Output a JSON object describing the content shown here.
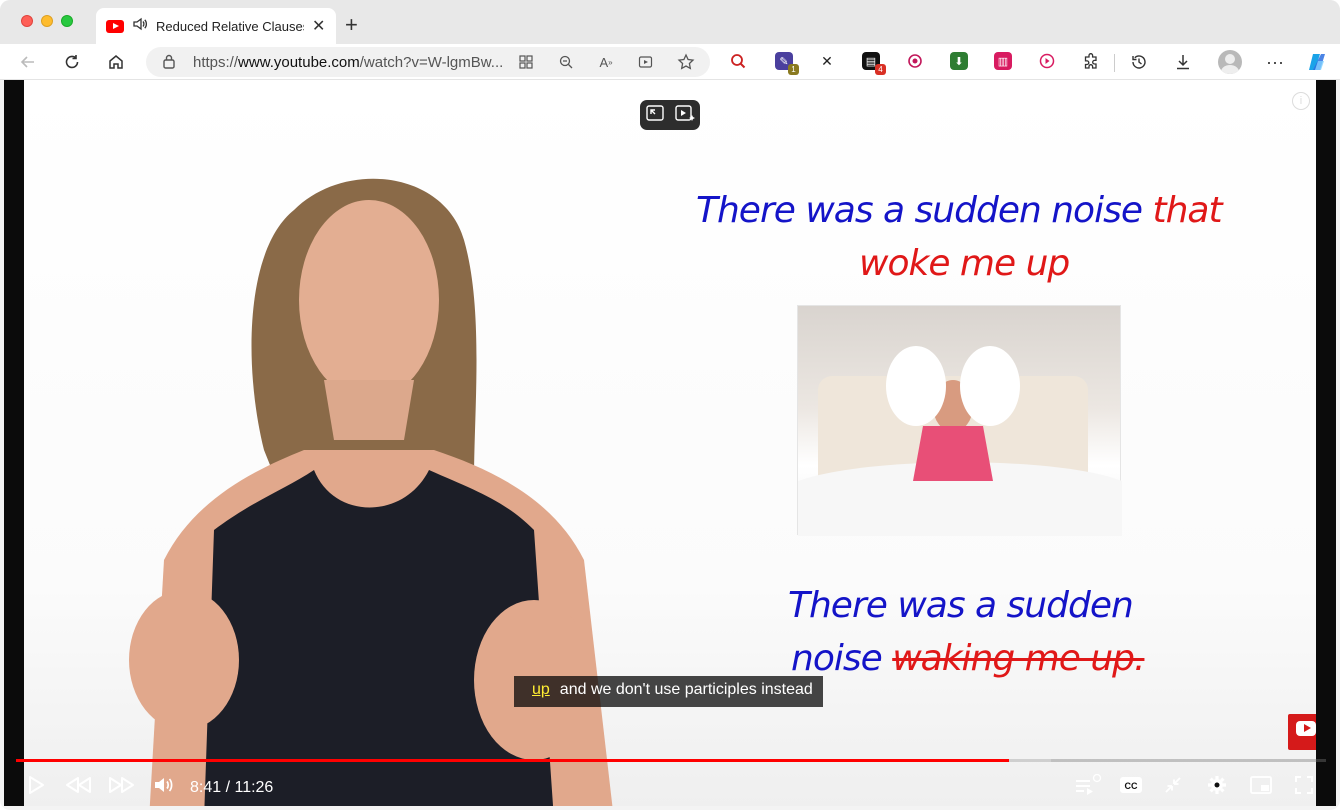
{
  "browser": {
    "tab": {
      "title": "Reduced Relative Clauses",
      "favicon": "youtube-icon",
      "audio_icon": "speaker-icon"
    },
    "url": {
      "prefix": "https://",
      "host": "www.youtube.com",
      "path": "/watch?v=W-lgmBw..."
    },
    "extension_badges": {
      "ext1": "1",
      "ext2": "4"
    },
    "colors": {
      "accent": "#1a73e8"
    }
  },
  "video": {
    "slide": {
      "line1_blue": "There was a sudden noise",
      "line1_red": "that",
      "line2_red": "woke me up",
      "line3_blue": "There was a sudden",
      "line4_blue": "noise",
      "line4_strike": "waking me up."
    },
    "caption": {
      "highlight": "up",
      "text": "and we don't use participles instead"
    },
    "player": {
      "current_time": "8:41",
      "duration": "11:26",
      "time_display": "8:41 / 11:26",
      "progress_played": 0.758,
      "progress_loaded": 0.79
    },
    "colors": {
      "progress": "#ff0000",
      "slide_blue": "#1414c8",
      "slide_red": "#e01818"
    }
  }
}
